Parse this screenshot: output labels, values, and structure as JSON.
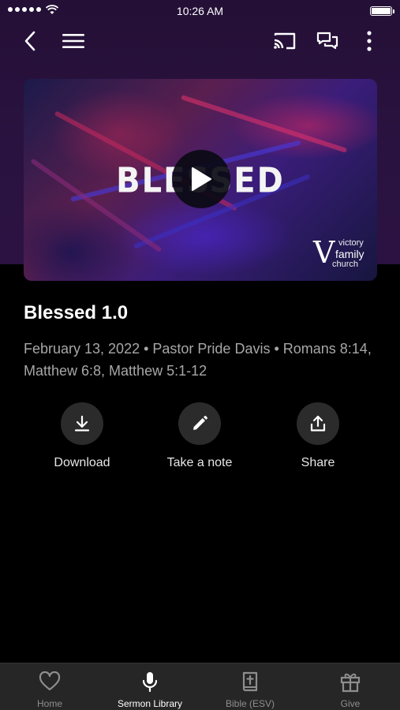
{
  "status_bar": {
    "time": "10:26 AM"
  },
  "video": {
    "title_text": "BLESSED",
    "logo": {
      "line1": "victory",
      "line2": "family",
      "line3": "church"
    }
  },
  "sermon": {
    "title": "Blessed 1.0",
    "meta": "February 13, 2022 • Pastor Pride Davis • Romans 8:14, Matthew 6:8, Matthew 5:1-12"
  },
  "actions": [
    {
      "label": "Download",
      "icon": "download-icon"
    },
    {
      "label": "Take a note",
      "icon": "pencil-icon"
    },
    {
      "label": "Share",
      "icon": "share-icon"
    }
  ],
  "tabs": [
    {
      "label": "Home",
      "icon": "heart-icon",
      "active": false
    },
    {
      "label": "Sermon Library",
      "icon": "microphone-icon",
      "active": true
    },
    {
      "label": "Bible (ESV)",
      "icon": "bible-icon",
      "active": false
    },
    {
      "label": "Give",
      "icon": "gift-icon",
      "active": false
    }
  ],
  "colors": {
    "header_bg": "#2a1240",
    "tab_bar_bg": "#262626",
    "meta_text": "#a7a7a7"
  }
}
